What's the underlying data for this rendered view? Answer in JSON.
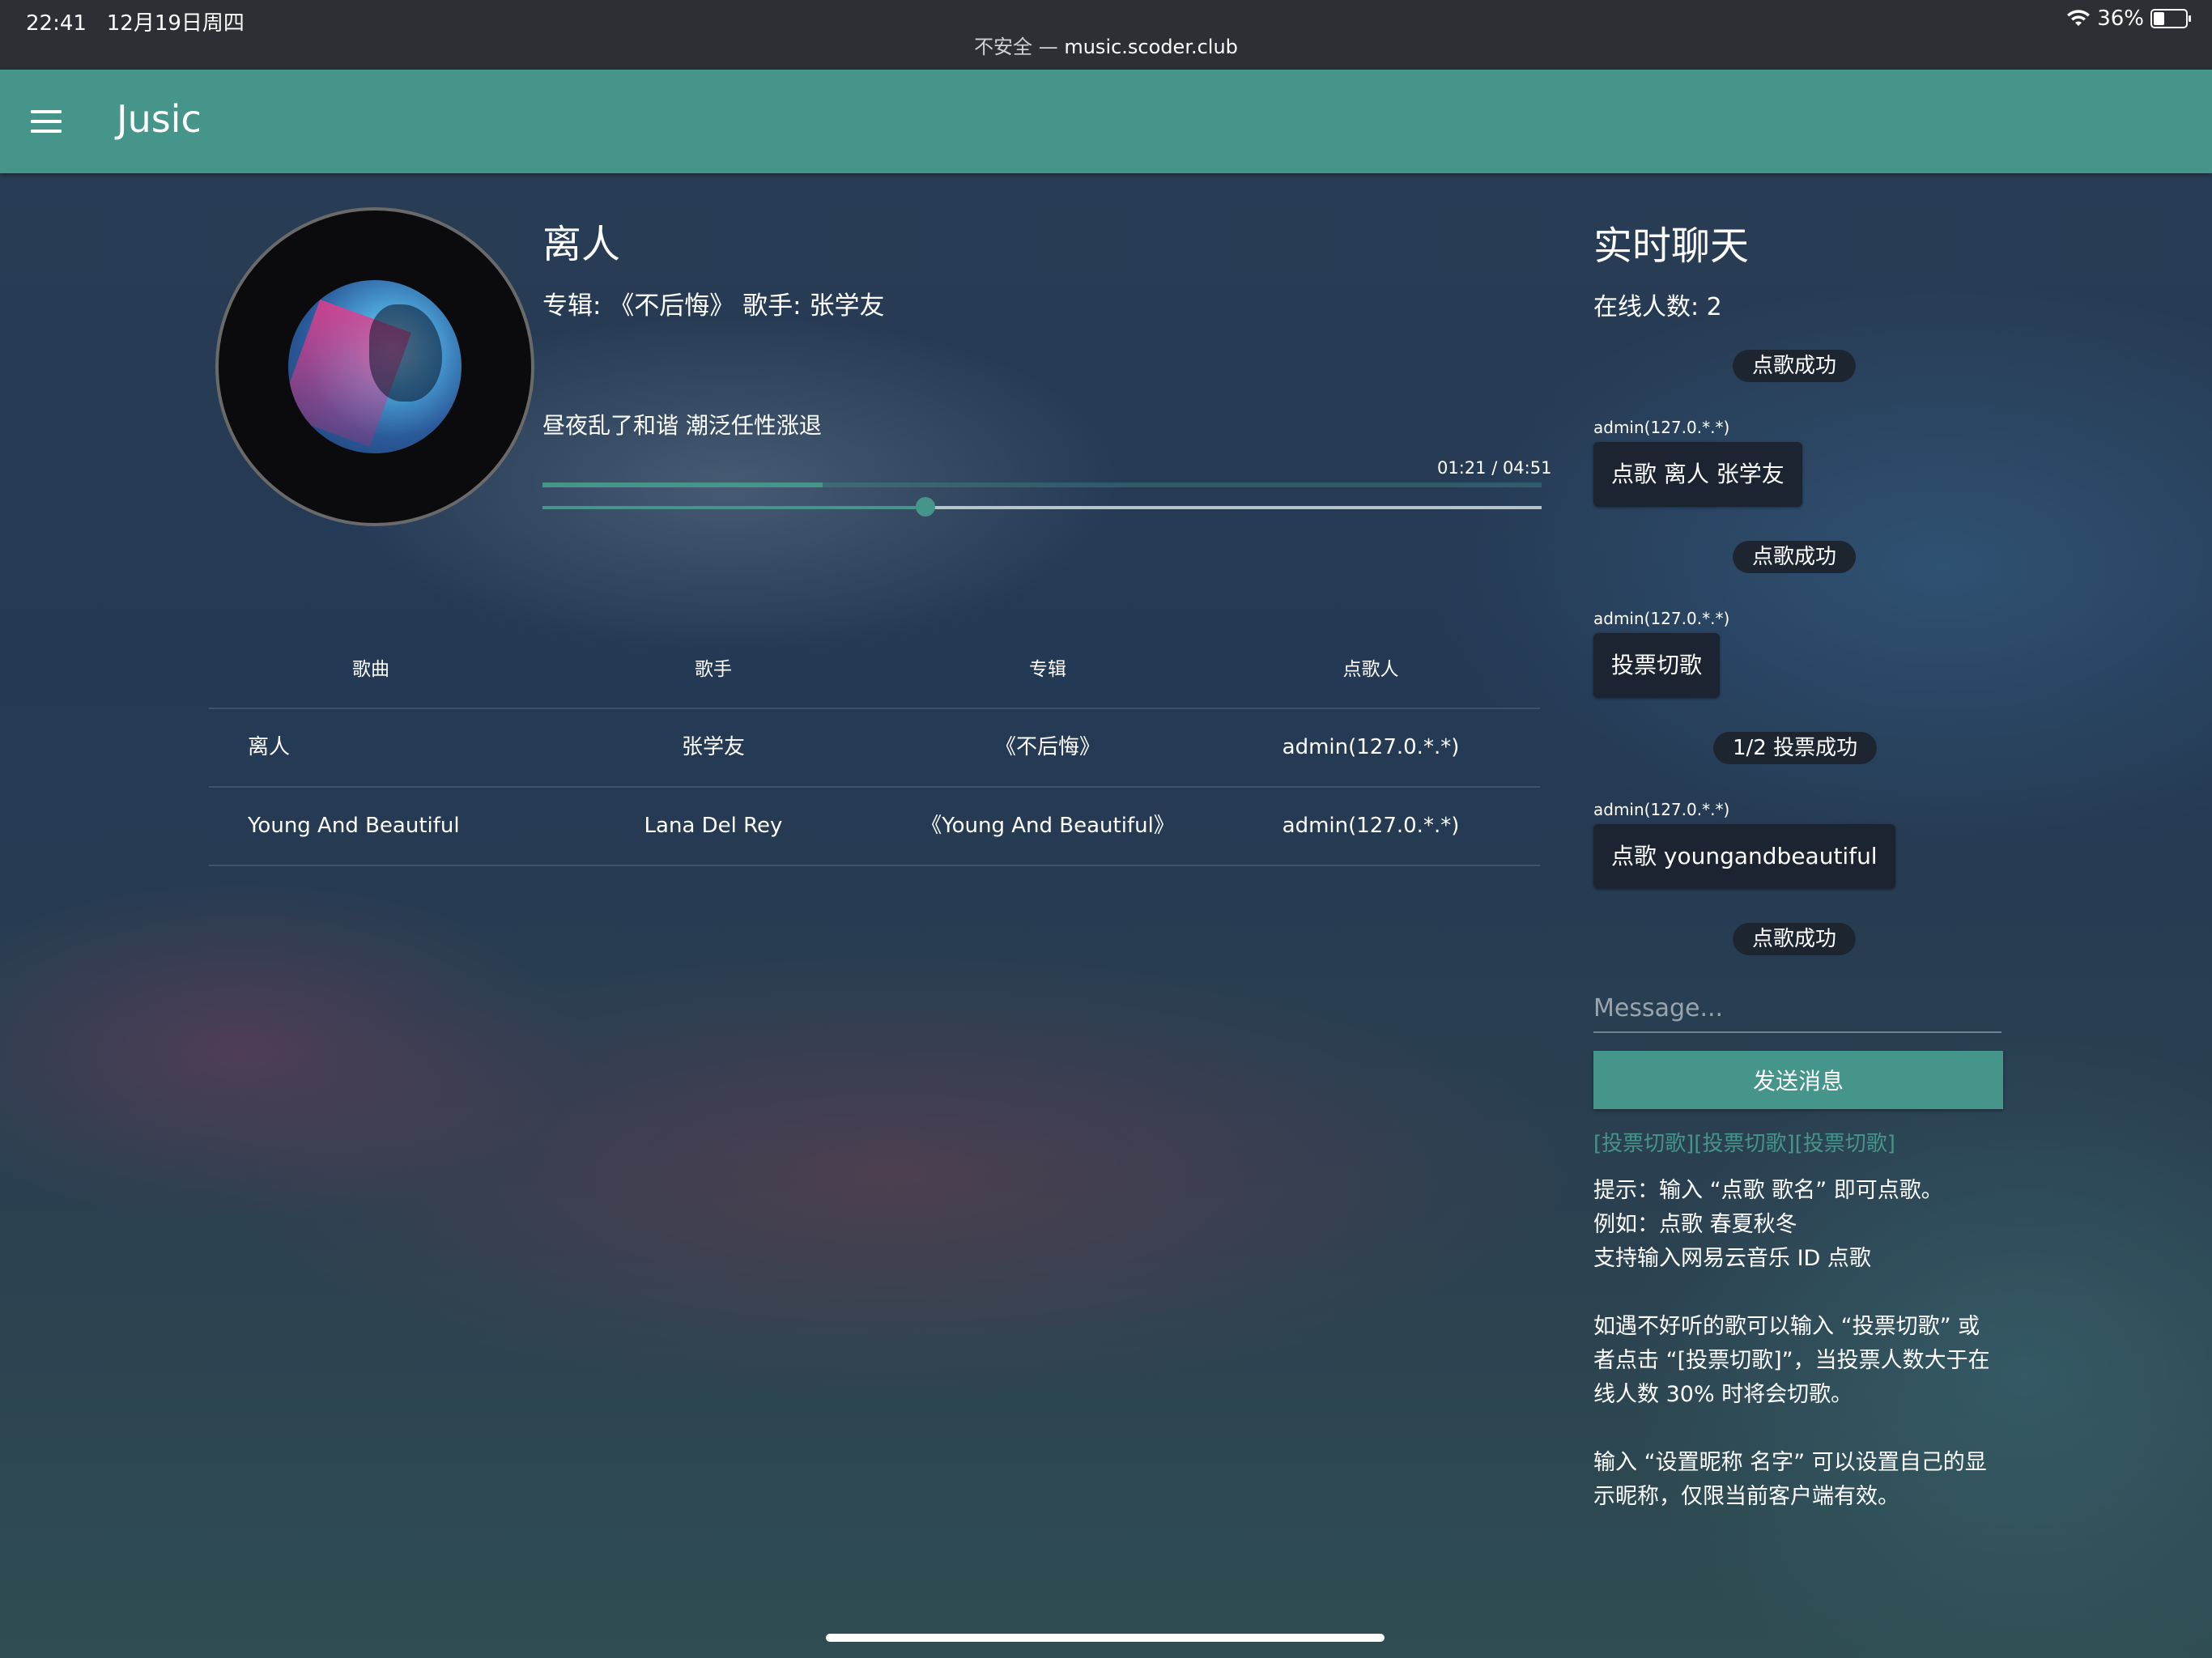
{
  "status_bar": {
    "time": "22:41",
    "date": "12月19日周四",
    "security": "不安全 —",
    "url": "music.scoder.club",
    "battery": "36%"
  },
  "app_bar": {
    "title": "Jusic"
  },
  "now_playing": {
    "title": "离人",
    "meta": "专辑: 《不后悔》 歌手: 张学友",
    "lyric": "昼夜乱了和谐 潮泛任性涨退",
    "time": "01:21 / 04:51",
    "buffer_fraction": 0.28,
    "position_fraction": 0.383
  },
  "playlist": {
    "headers": [
      "歌曲",
      "歌手",
      "专辑",
      "点歌人"
    ],
    "rows": [
      [
        "离人",
        "张学友",
        "《不后悔》",
        "admin(127.0.*.*)"
      ],
      [
        "Young And Beautiful",
        "Lana Del Rey",
        "《Young And Beautiful》",
        "admin(127.0.*.*)"
      ]
    ]
  },
  "chat": {
    "title": "实时聊天",
    "online": "在线人数: 2",
    "messages": [
      {
        "type": "system",
        "text": "点歌成功"
      },
      {
        "type": "user",
        "user": "admin(127.0.*.*)",
        "text": "点歌 离人 张学友"
      },
      {
        "type": "system",
        "text": "点歌成功"
      },
      {
        "type": "user",
        "user": "admin(127.0.*.*)",
        "text": "投票切歌"
      },
      {
        "type": "system",
        "text": "1/2 投票成功"
      },
      {
        "type": "user",
        "user": "admin(127.0.*.*)",
        "text": "点歌 youngandbeautiful"
      },
      {
        "type": "system",
        "text": "点歌成功"
      }
    ],
    "input_placeholder": "Message...",
    "send_label": "发送消息",
    "vote_links": [
      "[投票切歌]",
      "[投票切歌]",
      "[投票切歌]"
    ],
    "hints": {
      "p1": [
        "提示：输入 “点歌 歌名” 即可点歌。",
        "例如：点歌 春夏秋冬",
        "支持输入网易云音乐 ID 点歌"
      ],
      "p2": [
        "如遇不好听的歌可以输入 “投票切歌” 或",
        "者点击 “[投票切歌]”，当投票人数大于在",
        "线人数 30% 时将会切歌。"
      ],
      "p3": [
        "输入 “设置昵称 名字” 可以设置自己的显",
        "示昵称，仅限当前客户端有效。"
      ]
    }
  }
}
